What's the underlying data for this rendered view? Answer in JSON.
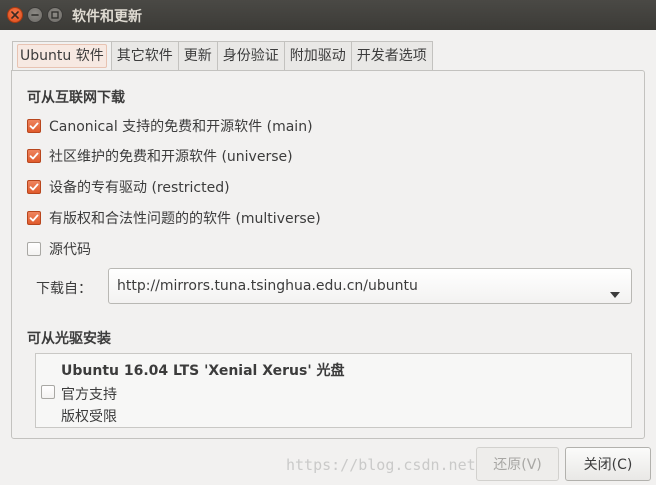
{
  "window": {
    "title": "软件和更新",
    "controls": [
      "close-icon",
      "minimize-icon",
      "maximize-icon"
    ]
  },
  "tabs": [
    {
      "label": "Ubuntu 软件",
      "active": true
    },
    {
      "label": "其它软件",
      "active": false
    },
    {
      "label": "更新",
      "active": false
    },
    {
      "label": "身份验证",
      "active": false
    },
    {
      "label": "附加驱动",
      "active": false
    },
    {
      "label": "开发者选项",
      "active": false
    }
  ],
  "internet": {
    "heading": "可从互联网下载",
    "items": [
      {
        "label": "Canonical 支持的免费和开源软件 (main)",
        "checked": true
      },
      {
        "label": "社区维护的免费和开源软件 (universe)",
        "checked": true
      },
      {
        "label": "设备的专有驱动 (restricted)",
        "checked": true
      },
      {
        "label": "有版权和合法性问题的的软件 (multiverse)",
        "checked": true
      },
      {
        "label": "源代码",
        "checked": false
      }
    ],
    "download_from_label": "下载自：",
    "download_from_value": "http://mirrors.tuna.tsinghua.edu.cn/ubuntu"
  },
  "cdrom": {
    "heading": "可从光驱安装",
    "title": "Ubuntu 16.04 LTS 'Xenial Xerus' 光盘",
    "lines": [
      "官方支持",
      "版权受限"
    ],
    "checked": false
  },
  "buttons": {
    "revert": "还原(V)",
    "close": "关闭(C)"
  },
  "watermark": "https://blog.csdn.net/MaTanYi",
  "colors": {
    "accent": "#e05a2b",
    "titlebar": "#3c3b37",
    "window_bg": "#f2f1f0"
  }
}
